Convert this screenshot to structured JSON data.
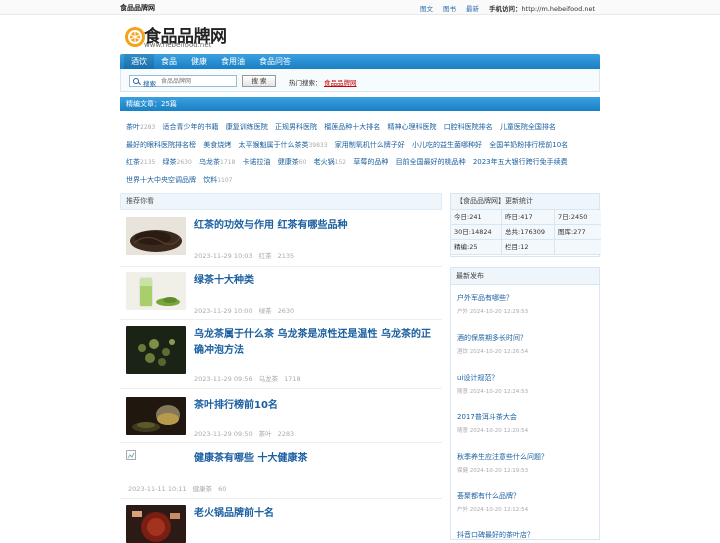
{
  "topbar": {
    "site_name": "食品品牌网",
    "links": [
      "图文",
      "图书",
      "最新"
    ],
    "mobile_label": "手机访问：",
    "mobile_url": "http://m.hebeifood.net"
  },
  "logo": {
    "text": "食品品牌网",
    "url": "www.hebeifood.net"
  },
  "nav": {
    "items": [
      "酒饮",
      "食品",
      "健康",
      "食用油",
      "食品问答"
    ]
  },
  "search": {
    "label": "搜索",
    "placeholder": "食品品牌网",
    "button": "搜 索",
    "hot_label": "热门搜索：",
    "hot_link": "食品品牌网"
  },
  "tags": {
    "header": "精编文章：25篇",
    "items": [
      {
        "name": "茶叶",
        "count": "2283"
      },
      {
        "name": "适合青少年的书籍",
        "count": ""
      },
      {
        "name": "康复训练医院",
        "count": ""
      },
      {
        "name": "正规男科医院",
        "count": ""
      },
      {
        "name": "榴莲品种十大排名",
        "count": ""
      },
      {
        "name": "精神心理科医院",
        "count": ""
      },
      {
        "name": "口腔科医院排名",
        "count": ""
      },
      {
        "name": "儿童医院全国排名",
        "count": ""
      },
      {
        "name": "最好的眼科医院排名榜",
        "count": ""
      },
      {
        "name": "美食烧烤",
        "count": ""
      },
      {
        "name": "太平猴魁属于什么茶类",
        "count": "39833"
      },
      {
        "name": "家用制氧机什么牌子好",
        "count": ""
      },
      {
        "name": "小儿吃的益生菌哪种好",
        "count": ""
      },
      {
        "name": "全国羊奶粉排行榜前10名",
        "count": ""
      },
      {
        "name": "红茶",
        "count": "2135"
      },
      {
        "name": "绿茶",
        "count": "2630"
      },
      {
        "name": "乌龙茶",
        "count": "1718"
      },
      {
        "name": "卡诺拉油",
        "count": ""
      },
      {
        "name": "健康茶",
        "count": "60"
      },
      {
        "name": "老火锅",
        "count": "152"
      },
      {
        "name": "草莓的品种",
        "count": ""
      },
      {
        "name": "目前全国最好的桃品种",
        "count": ""
      },
      {
        "name": "2023年五大银行跨行免手续费",
        "count": ""
      },
      {
        "name": "世界十大中央空调品牌",
        "count": ""
      },
      {
        "name": "饮料",
        "count": "1107"
      }
    ]
  },
  "recommend": {
    "header": "推荐你看",
    "articles": [
      {
        "title": "红茶的功效与作用 红茶有哪些品种",
        "date": "2023-11-29 10:03",
        "category": "红茶",
        "likes": "2135"
      },
      {
        "title": "绿茶十大种类",
        "date": "2023-11-29 10:00",
        "category": "绿茶",
        "likes": "2630"
      },
      {
        "title": "乌龙茶属于什么茶 乌龙茶是凉性还是温性 乌龙茶的正确冲泡方法",
        "date": "2023-11-29 09:56",
        "category": "乌龙茶",
        "likes": "1718"
      },
      {
        "title": "茶叶排行榜前10名",
        "date": "2023-11-29 09:50",
        "category": "茶叶",
        "likes": "2283"
      },
      {
        "title": "健康茶有哪些 十大健康茶",
        "date": "2023-11-11 10:11",
        "category": "健康茶",
        "likes": "60"
      },
      {
        "title": "老火锅品牌前十名",
        "date": "",
        "category": "",
        "likes": ""
      }
    ]
  },
  "stats": {
    "title": "【食品品牌网】更新统计",
    "cells": [
      "今日:241",
      "昨日:417",
      "7日:2450",
      "30日:14824",
      "总共:176309",
      "图库:277",
      "精编:25",
      "栏目:12",
      ""
    ]
  },
  "recent": {
    "title": "最新发布",
    "items": [
      {
        "title": "户外军品有哪些？",
        "meta": "户外 2024-10-20 12:29:53"
      },
      {
        "title": "酒的保质期多长时间？",
        "meta": "酒饮 2024-10-20 12:26:54"
      },
      {
        "title": "ui设计规范？",
        "meta": "随意 2024-10-20 12:24:53"
      },
      {
        "title": "2017普洱斗茶大会",
        "meta": "随意 2024-10-20 12:20:54"
      },
      {
        "title": "秋季养生应注意些什么问题？",
        "meta": "保健 2024-10-20 12:19:53"
      },
      {
        "title": "荟聚都有什么品牌？",
        "meta": "户外 2024-10-20 12:12:54"
      },
      {
        "title": "抖音口碑最好的茶叶店？",
        "meta": ""
      }
    ]
  }
}
